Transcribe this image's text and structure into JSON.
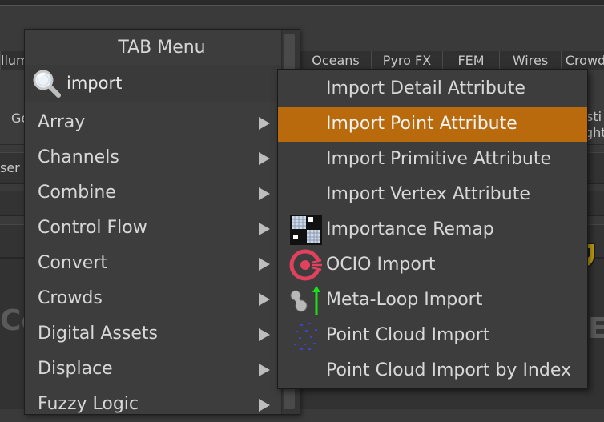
{
  "background": {
    "tabs": [
      "llum",
      "Oceans",
      "Pyro FX",
      "FEM",
      "Wires",
      "Crowd"
    ],
    "shelf_fragments": [
      "Ge",
      "sti",
      "ght"
    ],
    "row_fragment": "ser",
    "big_left": "Co",
    "big_right": "E"
  },
  "tab_menu": {
    "title": "TAB Menu",
    "search": {
      "value": "import",
      "icon": "magnifier-icon"
    },
    "categories": [
      {
        "label": "Array"
      },
      {
        "label": "Channels"
      },
      {
        "label": "Combine"
      },
      {
        "label": "Control Flow"
      },
      {
        "label": "Convert"
      },
      {
        "label": "Crowds"
      },
      {
        "label": "Digital Assets"
      },
      {
        "label": "Displace"
      },
      {
        "label": "Fuzzy Logic"
      }
    ]
  },
  "results": {
    "selected_index": 1,
    "selection_color": "#b86a0c",
    "items": [
      {
        "label": "Import Detail Attribute",
        "icon": ""
      },
      {
        "label": "Import Point Attribute",
        "icon": ""
      },
      {
        "label": "Import Primitive Attribute",
        "icon": ""
      },
      {
        "label": "Import Vertex Attribute",
        "icon": ""
      },
      {
        "label": "Importance Remap",
        "icon": "grid-remap-icon"
      },
      {
        "label": "OCIO Import",
        "icon": "ocio-icon"
      },
      {
        "label": "Meta-Loop Import",
        "icon": "metaball-arrow-icon"
      },
      {
        "label": "Point Cloud Import",
        "icon": "point-cloud-icon"
      },
      {
        "label": "Point Cloud Import by Index",
        "icon": ""
      }
    ]
  }
}
